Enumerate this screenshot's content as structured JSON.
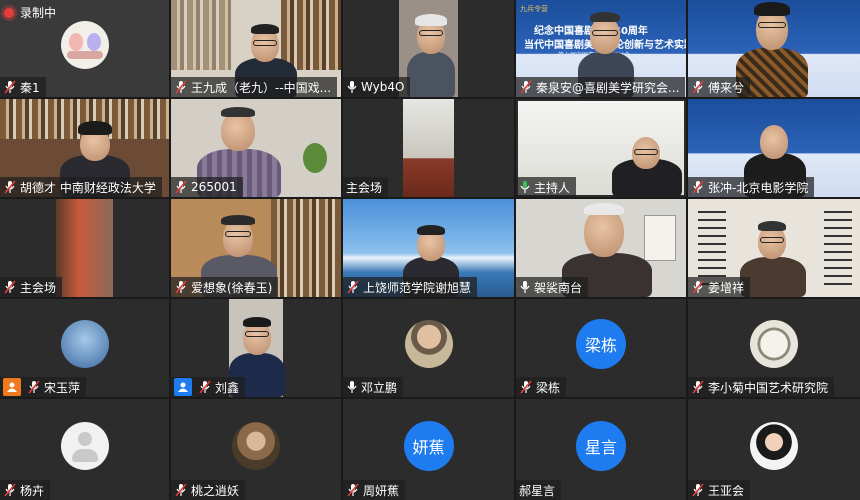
{
  "recording": {
    "label": "录制中"
  },
  "banner": {
    "top": "九兵令营",
    "line1": "纪念中国喜剧美学40周年",
    "line2": "当代中国喜剧美学理论创新与艺术实践",
    "line3": "——第七届中国喜剧美学研讨会"
  },
  "participants": [
    {
      "name": "秦1",
      "mic": "off"
    },
    {
      "name": "王九成（老九）--中国戏...",
      "mic": "off"
    },
    {
      "name": "Wyb4O",
      "mic": "on"
    },
    {
      "name": "秦泉安@喜剧美学研究会...",
      "mic": "off"
    },
    {
      "name": "傅来兮",
      "mic": "off"
    },
    {
      "name": "胡德才 中南财经政法大学",
      "mic": "off"
    },
    {
      "name": "265001",
      "mic": "off"
    },
    {
      "name": "主会场",
      "mic": "none"
    },
    {
      "name": "主持人",
      "mic": "on"
    },
    {
      "name": "张冲-北京电影学院",
      "mic": "off"
    },
    {
      "name": "主会场",
      "mic": "off"
    },
    {
      "name": "爱想象(徐春玉)",
      "mic": "off"
    },
    {
      "name": "上饶师范学院谢旭慧",
      "mic": "off"
    },
    {
      "name": "袈裟南台",
      "mic": "on"
    },
    {
      "name": "姜增祥",
      "mic": "off"
    },
    {
      "name": "宋玉萍",
      "mic": "off",
      "badge": "orange"
    },
    {
      "name": "刘鑫",
      "mic": "off",
      "badge": "blue"
    },
    {
      "name": "邓立鹏",
      "mic": "on"
    },
    {
      "name": "梁栋",
      "mic": "off",
      "avatar_text": "梁栋"
    },
    {
      "name": "李小菊中国艺术研究院",
      "mic": "off"
    },
    {
      "name": "杨卉",
      "mic": "off"
    },
    {
      "name": "桃之逍妖",
      "mic": "off"
    },
    {
      "name": "周妍蕉",
      "mic": "off",
      "avatar_text": "妍蕉"
    },
    {
      "name": "郝星言",
      "mic": "none",
      "avatar_text": "星言"
    },
    {
      "name": "王亚会",
      "mic": "off"
    }
  ],
  "colors": {
    "avatar_blue": "#1e7cf0",
    "active_border": "#3cc15a",
    "record_red": "#e53b3b"
  }
}
